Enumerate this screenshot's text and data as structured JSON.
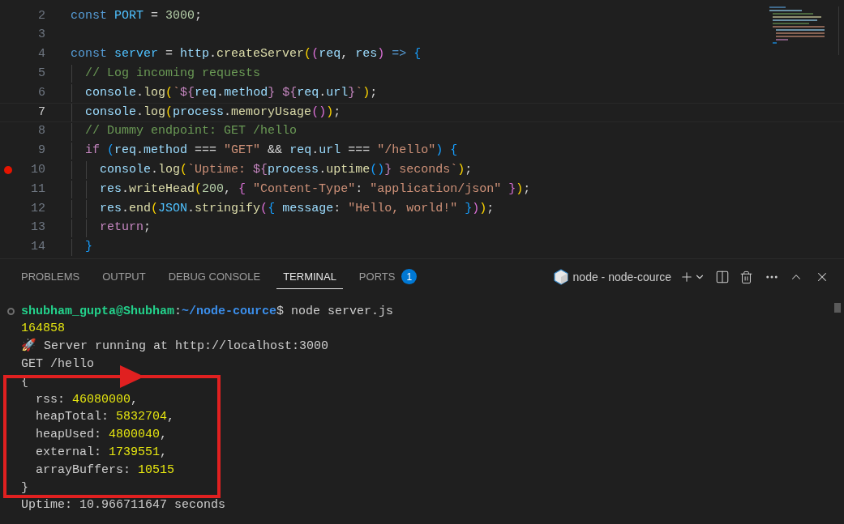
{
  "editor": {
    "lines": [
      {
        "number": "2",
        "current": false,
        "breakpoint": false,
        "tokens": [
          {
            "kind": "keyword",
            "text": "const "
          },
          {
            "kind": "constant",
            "text": "PORT"
          },
          {
            "kind": "punct",
            "text": " = "
          },
          {
            "kind": "number",
            "text": "3000"
          },
          {
            "kind": "punct",
            "text": ";"
          }
        ]
      },
      {
        "number": "3",
        "current": false,
        "breakpoint": false
      },
      {
        "number": "4",
        "current": false,
        "breakpoint": false,
        "tokens": [
          {
            "kind": "keyword",
            "text": "const "
          },
          {
            "kind": "constant",
            "text": "server"
          },
          {
            "kind": "punct",
            "text": " = "
          },
          {
            "kind": "variable",
            "text": "http"
          },
          {
            "kind": "punct",
            "text": "."
          },
          {
            "kind": "function",
            "text": "createServer"
          },
          {
            "kind": "bracket1",
            "text": "("
          },
          {
            "kind": "bracket2",
            "text": "("
          },
          {
            "kind": "variable",
            "text": "req"
          },
          {
            "kind": "punct",
            "text": ", "
          },
          {
            "kind": "variable",
            "text": "res"
          },
          {
            "kind": "bracket2",
            "text": ")"
          },
          {
            "kind": "keyword",
            "text": " => "
          },
          {
            "kind": "bracket3",
            "text": "{"
          }
        ]
      },
      {
        "number": "5",
        "current": false,
        "breakpoint": false,
        "tokens": [
          {
            "kind": "comment",
            "text": "  // Log incoming requests"
          }
        ]
      },
      {
        "number": "6",
        "current": false,
        "breakpoint": false,
        "tokens": [
          {
            "kind": "variable",
            "text": "  console"
          },
          {
            "kind": "punct",
            "text": "."
          },
          {
            "kind": "function",
            "text": "log"
          },
          {
            "kind": "bracket1",
            "text": "("
          },
          {
            "kind": "string",
            "text": "`"
          },
          {
            "kind": "control",
            "text": "${"
          },
          {
            "kind": "variable",
            "text": "req"
          },
          {
            "kind": "punct",
            "text": "."
          },
          {
            "kind": "variable",
            "text": "method"
          },
          {
            "kind": "control",
            "text": "} ${"
          },
          {
            "kind": "variable",
            "text": "req"
          },
          {
            "kind": "punct",
            "text": "."
          },
          {
            "kind": "variable",
            "text": "url"
          },
          {
            "kind": "control",
            "text": "}"
          },
          {
            "kind": "string",
            "text": "`"
          },
          {
            "kind": "bracket1",
            "text": ")"
          },
          {
            "kind": "punct",
            "text": ";"
          }
        ]
      },
      {
        "number": "7",
        "current": true,
        "breakpoint": false,
        "tokens": [
          {
            "kind": "variable",
            "text": "  console"
          },
          {
            "kind": "punct",
            "text": "."
          },
          {
            "kind": "function",
            "text": "log"
          },
          {
            "kind": "bracket1",
            "text": "("
          },
          {
            "kind": "variable",
            "text": "process"
          },
          {
            "kind": "punct",
            "text": "."
          },
          {
            "kind": "function",
            "text": "memoryUsage"
          },
          {
            "kind": "bracket2",
            "text": "()"
          },
          {
            "kind": "bracket1",
            "text": ")"
          },
          {
            "kind": "punct",
            "text": ";"
          }
        ]
      },
      {
        "number": "8",
        "current": false,
        "breakpoint": false,
        "tokens": [
          {
            "kind": "comment",
            "text": "  // Dummy endpoint: GET /hello"
          }
        ]
      },
      {
        "number": "9",
        "current": false,
        "breakpoint": false,
        "tokens": [
          {
            "kind": "control",
            "text": "  if "
          },
          {
            "kind": "bracket3",
            "text": "("
          },
          {
            "kind": "variable",
            "text": "req"
          },
          {
            "kind": "punct",
            "text": "."
          },
          {
            "kind": "variable",
            "text": "method"
          },
          {
            "kind": "punct",
            "text": " === "
          },
          {
            "kind": "string",
            "text": "\"GET\""
          },
          {
            "kind": "punct",
            "text": " && "
          },
          {
            "kind": "variable",
            "text": "req"
          },
          {
            "kind": "punct",
            "text": "."
          },
          {
            "kind": "variable",
            "text": "url"
          },
          {
            "kind": "punct",
            "text": " === "
          },
          {
            "kind": "string",
            "text": "\"/hello\""
          },
          {
            "kind": "bracket3",
            "text": ") {"
          }
        ]
      },
      {
        "number": "10",
        "current": false,
        "breakpoint": true,
        "tokens": [
          {
            "kind": "variable",
            "text": "    console"
          },
          {
            "kind": "punct",
            "text": "."
          },
          {
            "kind": "function",
            "text": "log"
          },
          {
            "kind": "bracket1",
            "text": "("
          },
          {
            "kind": "string",
            "text": "`Uptime: "
          },
          {
            "kind": "control",
            "text": "${"
          },
          {
            "kind": "variable",
            "text": "process"
          },
          {
            "kind": "punct",
            "text": "."
          },
          {
            "kind": "function",
            "text": "uptime"
          },
          {
            "kind": "bracket3",
            "text": "()"
          },
          {
            "kind": "control",
            "text": "}"
          },
          {
            "kind": "string",
            "text": " seconds`"
          },
          {
            "kind": "bracket1",
            "text": ")"
          },
          {
            "kind": "punct",
            "text": ";"
          }
        ]
      },
      {
        "number": "11",
        "current": false,
        "breakpoint": false,
        "tokens": [
          {
            "kind": "variable",
            "text": "    res"
          },
          {
            "kind": "punct",
            "text": "."
          },
          {
            "kind": "function",
            "text": "writeHead"
          },
          {
            "kind": "bracket1",
            "text": "("
          },
          {
            "kind": "number",
            "text": "200"
          },
          {
            "kind": "punct",
            "text": ", "
          },
          {
            "kind": "bracket2",
            "text": "{ "
          },
          {
            "kind": "string",
            "text": "\"Content-Type\""
          },
          {
            "kind": "punct",
            "text": ": "
          },
          {
            "kind": "string",
            "text": "\"application/json\""
          },
          {
            "kind": "bracket2",
            "text": " }"
          },
          {
            "kind": "bracket1",
            "text": ")"
          },
          {
            "kind": "punct",
            "text": ";"
          }
        ]
      },
      {
        "number": "12",
        "current": false,
        "breakpoint": false,
        "tokens": [
          {
            "kind": "variable",
            "text": "    res"
          },
          {
            "kind": "punct",
            "text": "."
          },
          {
            "kind": "function",
            "text": "end"
          },
          {
            "kind": "bracket1",
            "text": "("
          },
          {
            "kind": "constant",
            "text": "JSON"
          },
          {
            "kind": "punct",
            "text": "."
          },
          {
            "kind": "function",
            "text": "stringify"
          },
          {
            "kind": "bracket2",
            "text": "("
          },
          {
            "kind": "bracket3",
            "text": "{"
          },
          {
            "kind": "variable",
            "text": " message"
          },
          {
            "kind": "punct",
            "text": ": "
          },
          {
            "kind": "string",
            "text": "\"Hello, world!\""
          },
          {
            "kind": "bracket3",
            "text": " }"
          },
          {
            "kind": "bracket2",
            "text": ")"
          },
          {
            "kind": "bracket1",
            "text": ")"
          },
          {
            "kind": "punct",
            "text": ";"
          }
        ]
      },
      {
        "number": "13",
        "current": false,
        "breakpoint": false,
        "tokens": [
          {
            "kind": "control",
            "text": "    return"
          },
          {
            "kind": "punct",
            "text": ";"
          }
        ]
      },
      {
        "number": "14",
        "current": false,
        "breakpoint": false,
        "tokens": [
          {
            "kind": "bracket3",
            "text": "  }"
          }
        ]
      }
    ]
  },
  "panel": {
    "tabs": [
      {
        "label": "PROBLEMS",
        "selected": false
      },
      {
        "label": "OUTPUT",
        "selected": false
      },
      {
        "label": "DEBUG CONSOLE",
        "selected": false
      },
      {
        "label": "TERMINAL",
        "selected": true
      },
      {
        "label": "PORTS",
        "selected": false,
        "badge": "1"
      }
    ],
    "terminal_name": "node - node-cource",
    "terminal": [
      {
        "prompt": true,
        "tokens": [
          {
            "kind": "user",
            "text": "shubham_gupta@Shubham"
          },
          {
            "kind": "plain",
            "text": ":"
          },
          {
            "kind": "path",
            "text": "~/node-cource"
          },
          {
            "kind": "plain",
            "text": "$ node server.js"
          }
        ]
      },
      {
        "prompt": false,
        "tokens": [
          {
            "kind": "yellow",
            "text": "164858"
          }
        ]
      },
      {
        "prompt": false,
        "tokens": [
          {
            "kind": "plain",
            "text": "🚀 Server running at http://localhost:3000"
          }
        ]
      },
      {
        "prompt": false,
        "tokens": [
          {
            "kind": "plain",
            "text": "GET /hello"
          }
        ]
      },
      {
        "prompt": false,
        "tokens": [
          {
            "kind": "plain",
            "text": "{"
          }
        ]
      },
      {
        "prompt": false,
        "tokens": [
          {
            "kind": "plain",
            "text": "  rss: "
          },
          {
            "kind": "yellow",
            "text": "46080000"
          },
          {
            "kind": "plain",
            "text": ","
          }
        ]
      },
      {
        "prompt": false,
        "tokens": [
          {
            "kind": "plain",
            "text": "  heapTotal: "
          },
          {
            "kind": "yellow",
            "text": "5832704"
          },
          {
            "kind": "plain",
            "text": ","
          }
        ]
      },
      {
        "prompt": false,
        "tokens": [
          {
            "kind": "plain",
            "text": "  heapUsed: "
          },
          {
            "kind": "yellow",
            "text": "4800040"
          },
          {
            "kind": "plain",
            "text": ","
          }
        ]
      },
      {
        "prompt": false,
        "tokens": [
          {
            "kind": "plain",
            "text": "  external: "
          },
          {
            "kind": "yellow",
            "text": "1739551"
          },
          {
            "kind": "plain",
            "text": ","
          }
        ]
      },
      {
        "prompt": false,
        "tokens": [
          {
            "kind": "plain",
            "text": "  arrayBuffers: "
          },
          {
            "kind": "yellow",
            "text": "10515"
          }
        ]
      },
      {
        "prompt": false,
        "tokens": [
          {
            "kind": "plain",
            "text": "}"
          }
        ]
      },
      {
        "prompt": false,
        "tokens": [
          {
            "kind": "plain",
            "text": "Uptime: 10.966711647 seconds"
          }
        ]
      }
    ]
  }
}
